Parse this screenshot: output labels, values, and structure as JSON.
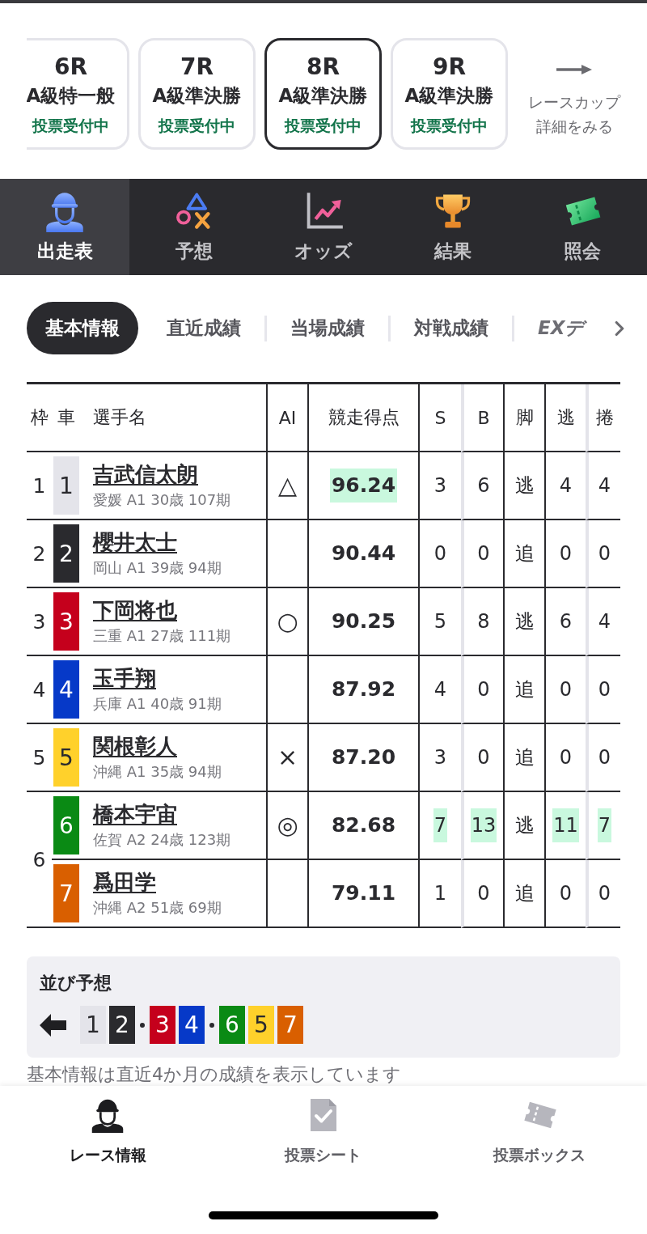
{
  "race_cards": [
    {
      "race": "6R",
      "grade": "A級特一般",
      "status": "投票受付中",
      "selected": false
    },
    {
      "race": "7R",
      "grade": "A級準決勝",
      "status": "投票受付中",
      "selected": false
    },
    {
      "race": "8R",
      "grade": "A級準決勝",
      "status": "投票受付中",
      "selected": true
    },
    {
      "race": "9R",
      "grade": "A級準決勝",
      "status": "投票受付中",
      "selected": false
    }
  ],
  "race_cup_link": {
    "lines": [
      "レースカップ",
      "詳細をみる"
    ]
  },
  "nav_tabs": [
    {
      "label": "出走表",
      "selected": true
    },
    {
      "label": "予想",
      "selected": false
    },
    {
      "label": "オッズ",
      "selected": false
    },
    {
      "label": "結果",
      "selected": false
    },
    {
      "label": "照会",
      "selected": false
    }
  ],
  "info_tabs": [
    {
      "label": "基本情報",
      "kind": "label",
      "selected": true
    },
    {
      "label": "直近成績",
      "kind": "label",
      "selected": false
    },
    {
      "label": "当場成績",
      "kind": "label",
      "selected": false
    },
    {
      "label": "対戦成績",
      "kind": "label",
      "selected": false
    },
    {
      "label": "EXデ",
      "kind": "brand",
      "selected": false
    }
  ],
  "entry_table": {
    "columns": [
      "枠",
      "車",
      "選手名",
      "AI",
      "競走得点",
      "S",
      "B",
      "脚",
      "逃",
      "捲"
    ],
    "frames": [
      {
        "frame": "1",
        "entries": [
          {
            "car": "1",
            "color": "#e4e4ea",
            "name": "吉武信太朗",
            "profile": "愛媛 A1 30歳 107期",
            "ai": "△",
            "score": {
              "text": "96.24",
              "highlighted": true
            },
            "stats": [
              {
                "text": "3",
                "highlighted": false
              },
              {
                "text": "6",
                "highlighted": false
              },
              {
                "text": "逃",
                "highlighted": false
              },
              {
                "text": "4",
                "highlighted": false
              },
              {
                "text": "4",
                "highlighted": false
              }
            ]
          }
        ]
      },
      {
        "frame": "2",
        "entries": [
          {
            "car": "2",
            "color": "#2a2a2e",
            "name": "櫻井太士",
            "profile": "岡山 A1 39歳 94期",
            "score": {
              "text": "90.44",
              "highlighted": false
            },
            "stats": [
              {
                "text": "0",
                "highlighted": false
              },
              {
                "text": "0",
                "highlighted": false
              },
              {
                "text": "追",
                "highlighted": false
              },
              {
                "text": "0",
                "highlighted": false
              },
              {
                "text": "0",
                "highlighted": false
              }
            ]
          }
        ]
      },
      {
        "frame": "3",
        "entries": [
          {
            "car": "3",
            "color": "#c5001c",
            "name": "下岡将也",
            "profile": "三重 A1 27歳 111期",
            "ai": "○",
            "score": {
              "text": "90.25",
              "highlighted": false
            },
            "stats": [
              {
                "text": "5",
                "highlighted": false
              },
              {
                "text": "8",
                "highlighted": false
              },
              {
                "text": "逃",
                "highlighted": false
              },
              {
                "text": "6",
                "highlighted": false
              },
              {
                "text": "4",
                "highlighted": false
              }
            ]
          }
        ]
      },
      {
        "frame": "4",
        "entries": [
          {
            "car": "4",
            "color": "#0639c8",
            "name": "玉手翔",
            "profile": "兵庫 A1 40歳 91期",
            "score": {
              "text": "87.92",
              "highlighted": false
            },
            "stats": [
              {
                "text": "4",
                "highlighted": false
              },
              {
                "text": "0",
                "highlighted": false
              },
              {
                "text": "追",
                "highlighted": false
              },
              {
                "text": "0",
                "highlighted": false
              },
              {
                "text": "0",
                "highlighted": false
              }
            ]
          }
        ]
      },
      {
        "frame": "5",
        "entries": [
          {
            "car": "5",
            "color": "#ffd12b",
            "name": "関根彰人",
            "profile": "沖縄 A1 35歳 94期",
            "ai": "×",
            "score": {
              "text": "87.20",
              "highlighted": false
            },
            "stats": [
              {
                "text": "3",
                "highlighted": false
              },
              {
                "text": "0",
                "highlighted": false
              },
              {
                "text": "追",
                "highlighted": false
              },
              {
                "text": "0",
                "highlighted": false
              },
              {
                "text": "0",
                "highlighted": false
              }
            ]
          }
        ]
      },
      {
        "frame": "6",
        "entries": [
          {
            "car": "6",
            "color": "#0a8a14",
            "name": "橋本宇宙",
            "profile": "佐賀 A2 24歳 123期",
            "ai": "◎",
            "score": {
              "text": "82.68",
              "highlighted": false
            },
            "stats": [
              {
                "text": "7",
                "highlighted": true
              },
              {
                "text": "13",
                "highlighted": true
              },
              {
                "text": "逃",
                "highlighted": false
              },
              {
                "text": "11",
                "highlighted": true
              },
              {
                "text": "7",
                "highlighted": true
              }
            ]
          },
          {
            "car": "7",
            "color": "#d95f00",
            "name": "爲田学",
            "profile": "沖縄 A2 51歳 69期",
            "score": {
              "text": "79.11",
              "highlighted": false
            },
            "stats": [
              {
                "text": "1",
                "highlighted": false
              },
              {
                "text": "0",
                "highlighted": false
              },
              {
                "text": "追",
                "highlighted": false
              },
              {
                "text": "0",
                "highlighted": false
              },
              {
                "text": "0",
                "highlighted": false
              }
            ]
          }
        ]
      }
    ]
  },
  "lineup": {
    "title": "並び予想",
    "groups": [
      {
        "cars": [
          {
            "car": "1",
            "color": "#e4e4ea"
          },
          {
            "car": "2",
            "color": "#2a2a2e"
          }
        ]
      },
      {
        "cars": [
          {
            "car": "3",
            "color": "#c5001c"
          },
          {
            "car": "4",
            "color": "#0639c8"
          }
        ]
      },
      {
        "cars": [
          {
            "car": "6",
            "color": "#0a8a14"
          },
          {
            "car": "5",
            "color": "#ffd12b"
          },
          {
            "car": "7",
            "color": "#d95f00"
          }
        ]
      }
    ]
  },
  "footnote": "基本情報は直近4か月の成績を表示しています",
  "bottom_tabs": [
    {
      "label": "レース情報",
      "selected": true
    },
    {
      "label": "投票シート",
      "selected": false
    },
    {
      "label": "投票ボックス",
      "selected": false
    }
  ]
}
